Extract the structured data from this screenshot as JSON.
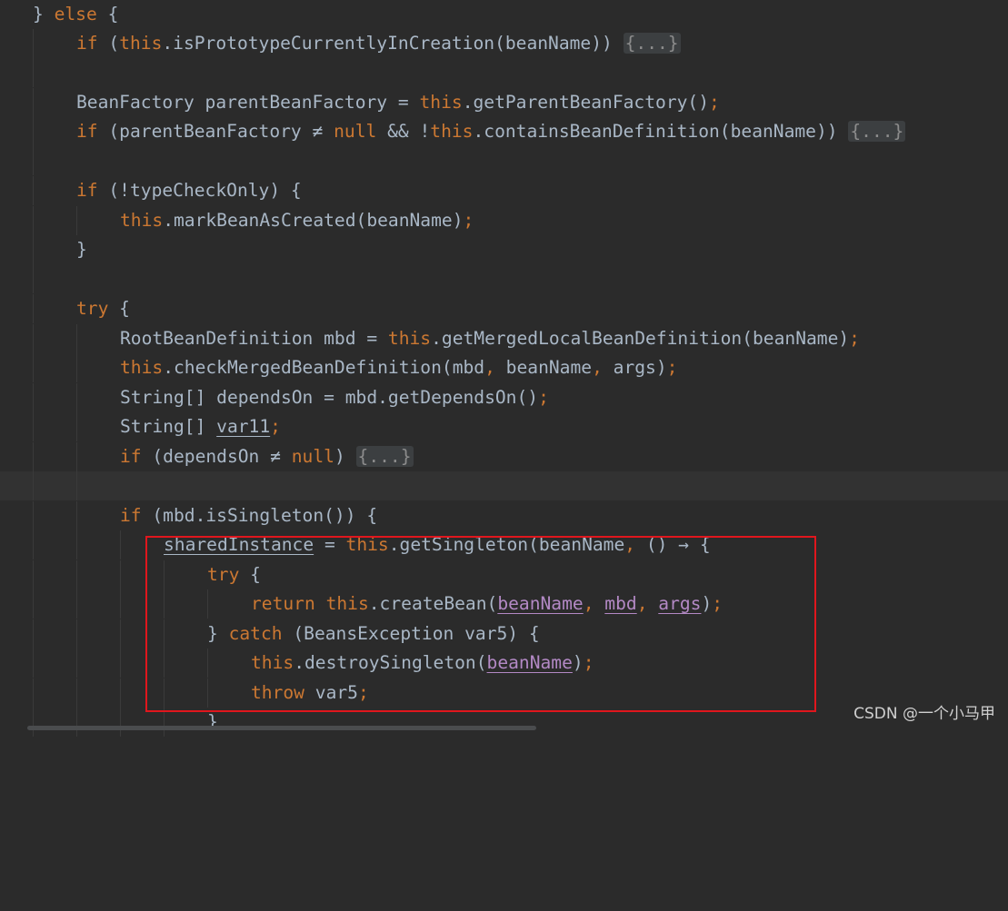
{
  "editor": {
    "lines": {
      "l1": {
        "brace": "} ",
        "else": "else",
        "rest": " {"
      },
      "l2": {
        "if": "if",
        "open": " (",
        "this": "this",
        "call": ".isPrototypeCurrentlyInCreation(beanName)) ",
        "fold": "{...}"
      },
      "l4": {
        "decl": "BeanFactory parentBeanFactory = ",
        "this": "this",
        "call": ".getParentBeanFactory()",
        "semi": ";"
      },
      "l5": {
        "if": "if",
        "a": " (parentBeanFactory ≠ ",
        "null": "null",
        "b": " && !",
        "this": "this",
        "call": ".containsBeanDefinition(beanName)) ",
        "fold": "{...}"
      },
      "l7": {
        "if": "if",
        "rest": " (!typeCheckOnly) {"
      },
      "l8": {
        "this": "this",
        "call": ".markBeanAsCreated(beanName)",
        "semi": ";"
      },
      "l9": {
        "brace": "}"
      },
      "l11": {
        "try": "try",
        "rest": " {"
      },
      "l12": {
        "decl": "RootBeanDefinition mbd = ",
        "this": "this",
        "call": ".getMergedLocalBeanDefinition(beanName)",
        "semi": ";"
      },
      "l13": {
        "this": "this",
        "a": ".checkMergedBeanDefinition(mbd",
        "c1": ",",
        "b": " beanName",
        "c2": ",",
        "c": " args)",
        "semi": ";"
      },
      "l14": {
        "decl": "String[] dependsOn = mbd.getDependsOn()",
        "semi": ";"
      },
      "l15": {
        "decl": "String[] ",
        "var": "var11",
        "semi": ";"
      },
      "l16": {
        "if": "if",
        "a": " (dependsOn ≠ ",
        "null": "null",
        "b": ") ",
        "fold": "{...}"
      },
      "l18": {
        "if": "if",
        "rest": " (mbd.isSingleton()) {"
      },
      "l19": {
        "var": "sharedInstance",
        "a": " = ",
        "this": "this",
        "b": ".getSingleton(beanName",
        "c": ",",
        "d": " () → {"
      },
      "l20": {
        "try": "try",
        "rest": " {"
      },
      "l21": {
        "return": "return",
        "sp": " ",
        "this": "this",
        "a": ".createBean(",
        "p1": "beanName",
        "c1": ",",
        "sp1": " ",
        "p2": "mbd",
        "c2": ",",
        "sp2": " ",
        "p3": "args",
        "b": ")",
        "semi": ";"
      },
      "l22": {
        "brace": "} ",
        "catch": "catch",
        "rest": " (BeansException var5) {"
      },
      "l23": {
        "this": "this",
        "a": ".destroySingleton(",
        "p": "beanName",
        "b": ")",
        "semi": ";"
      },
      "l24": {
        "throw": "throw",
        "rest": " var5",
        "semi": ";"
      },
      "l25": {
        "brace": "}"
      }
    }
  },
  "watermark": "CSDN @一个小马甲",
  "colors": {
    "background": "#2b2b2b",
    "keyword": "#cc7832",
    "text": "#a9b7c6",
    "captured_param": "#b389c5",
    "highlight_box": "#e0161d"
  }
}
